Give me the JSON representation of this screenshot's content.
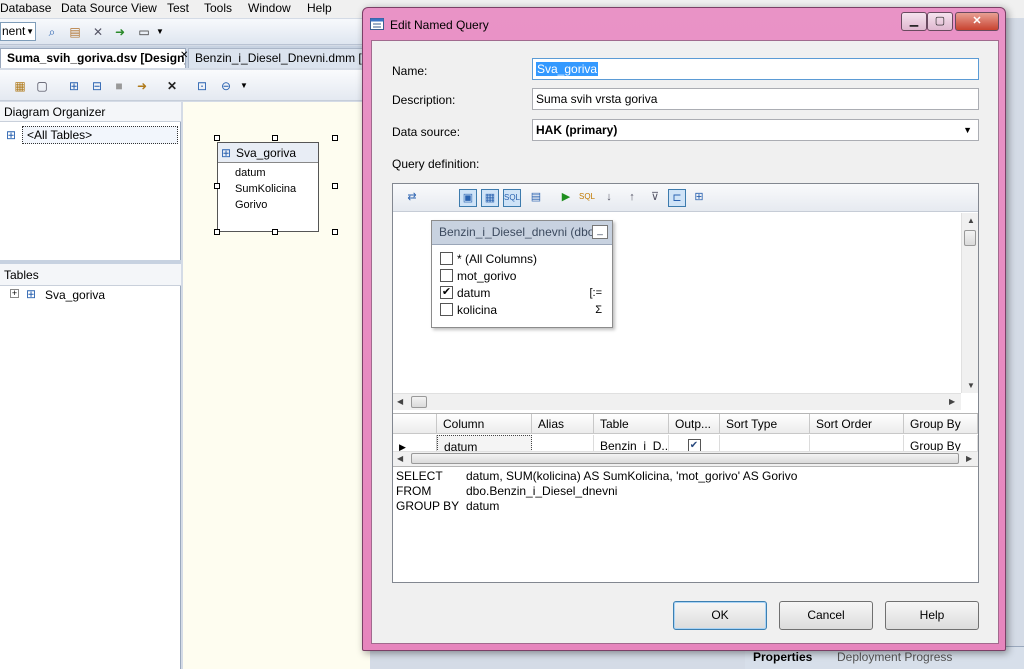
{
  "ide": {
    "menu": [
      "Database",
      "Data Source View",
      "Test",
      "Tools",
      "Window",
      "Help"
    ],
    "toolbar_combo": "nent",
    "tabs": [
      {
        "label": "Suma_svih_goriva.dsv [Design]*",
        "active": true
      },
      {
        "label": "Benzin_i_Diesel_Dnevni.dmm [",
        "active": false
      }
    ],
    "diagram_organizer": {
      "title": "Diagram Organizer",
      "item": "<All Tables>"
    },
    "tables_panel": {
      "title": "Tables",
      "item": "Sva_goriva"
    },
    "diagram_table": {
      "name": "Sva_goriva",
      "fields": [
        "datum",
        "SumKolicina",
        "Gorivo"
      ]
    },
    "bottom_tabs": [
      "Properties",
      "Deployment Progress"
    ]
  },
  "dialog": {
    "title": "Edit Named Query",
    "labels": {
      "name": "Name:",
      "description": "Description:",
      "data_source": "Data source:",
      "query_definition": "Query definition:"
    },
    "name_value": "Sva_goriva",
    "description_value": "Suma svih vrsta goriva",
    "data_source_value": "HAK (primary)",
    "query_table": {
      "title": "Benzin_i_Diesel_dnevni (dbo",
      "columns": [
        {
          "label": "* (All Columns)",
          "checked": false,
          "icon": ""
        },
        {
          "label": "mot_gorivo",
          "checked": false,
          "icon": ""
        },
        {
          "label": "datum",
          "checked": true,
          "icon": "group-by-icon"
        },
        {
          "label": "kolicina",
          "checked": false,
          "icon": "sum-icon"
        }
      ]
    },
    "grid": {
      "headers": [
        "Column",
        "Alias",
        "Table",
        "Outp...",
        "Sort Type",
        "Sort Order",
        "Group By"
      ],
      "row": {
        "column": "datum",
        "alias": "",
        "table": "Benzin_i_D...",
        "output": true,
        "sort_type": "",
        "sort_order": "",
        "group_by": "Group By"
      }
    },
    "sql": [
      {
        "kw": "SELECT",
        "rest": "datum, SUM(kolicina) AS SumKolicina, 'mot_gorivo' AS Gorivo"
      },
      {
        "kw": "FROM",
        "rest": "dbo.Benzin_i_Diesel_dnevni"
      },
      {
        "kw": "GROUP BY",
        "rest": "datum"
      }
    ],
    "buttons": {
      "ok": "OK",
      "cancel": "Cancel",
      "help": "Help"
    }
  }
}
